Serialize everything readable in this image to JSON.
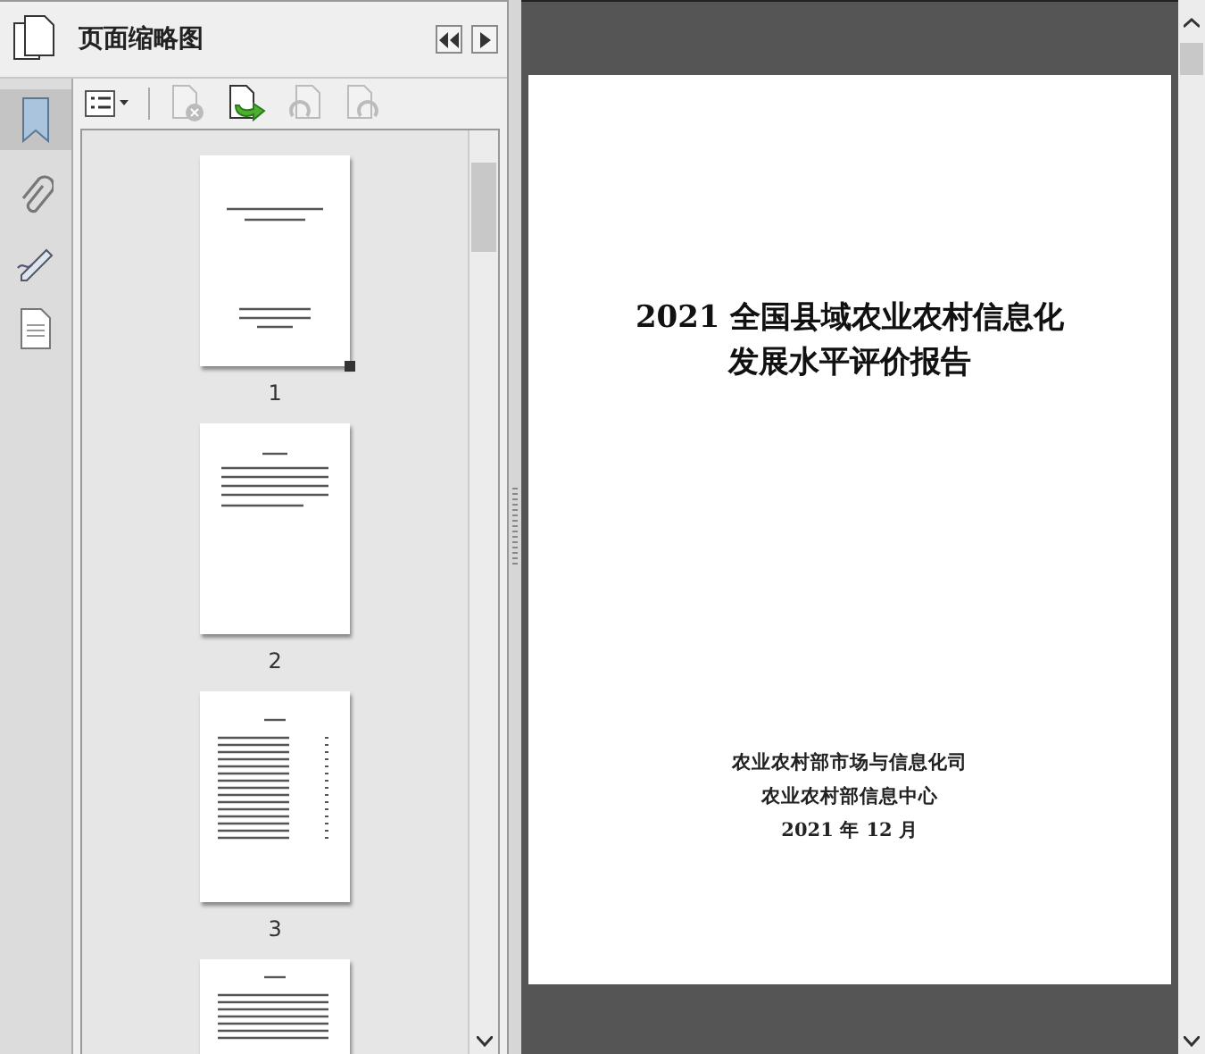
{
  "panel": {
    "title": "页面缩略图"
  },
  "thumbnails": [
    {
      "label": "1",
      "kind": "cover",
      "selected": true
    },
    {
      "label": "2",
      "kind": "text",
      "selected": false
    },
    {
      "label": "3",
      "kind": "toc",
      "selected": false
    },
    {
      "kind": "list",
      "selected": false
    }
  ],
  "document": {
    "title_lines": [
      "2021 全国县域农业农村信息化",
      "发展水平评价报告"
    ],
    "footer_lines": [
      "农业农村部市场与信息化司",
      "农业农村部信息中心",
      "2021 年 12 月"
    ]
  }
}
